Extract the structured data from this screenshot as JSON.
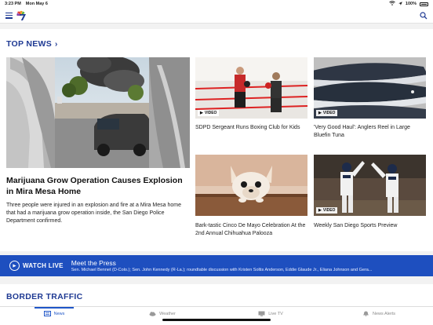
{
  "status_bar": {
    "time": "3:23 PM",
    "date": "Mon May 6",
    "battery": "100%"
  },
  "header": {
    "logo_icon": "nbc-7-logo-icon",
    "menu_icon": "hamburger-menu-icon",
    "search_icon": "search-icon",
    "accent_color": "#1f3a93"
  },
  "top_news": {
    "section_label": "TOP NEWS",
    "chevron": "›",
    "lead": {
      "title": "Marijuana Grow Operation Causes Explosion in Mira Mesa Home",
      "description": "Three people were injured in an explosion and fire at a Mira Mesa home that had a marijuana grow operation inside, the San Diego Police Department confirmed."
    },
    "cards": [
      {
        "title": "SDPD Sergeant Runs Boxing Club for Kids",
        "badge": "VIDEO"
      },
      {
        "title": "'Very Good Haul': Anglers Reel in Large Bluefin Tuna",
        "badge": "VIDEO"
      },
      {
        "title": "Bark-tastic Cinco De Mayo Celebration At the 2nd Annual Chihuahua Palooza",
        "badge": ""
      },
      {
        "title": "Weekly San Diego Sports Preview",
        "badge": "VIDEO"
      }
    ]
  },
  "watch_live": {
    "label": "WATCH LIVE",
    "show_title": "Meet the Press",
    "show_description": "Sen. Michael Bennet (D-Colo.); Sen. John Kennedy (R-La.); roundtable discussion with Kristen Soltis Anderson, Eddie Glaude Jr., Eliana Johnson and Gera...",
    "banner_color": "#1e4fbf"
  },
  "border_traffic": {
    "section_label": "BORDER TRAFFIC"
  },
  "tab_bar": {
    "tabs": [
      {
        "label": "News",
        "icon": "news-icon",
        "active": true
      },
      {
        "label": "Weather",
        "icon": "weather-cloud-icon",
        "active": false
      },
      {
        "label": "Live TV",
        "icon": "tv-icon",
        "active": false
      },
      {
        "label": "News Alerts",
        "icon": "bell-icon",
        "active": false
      }
    ],
    "active_color": "#1f56c8"
  }
}
